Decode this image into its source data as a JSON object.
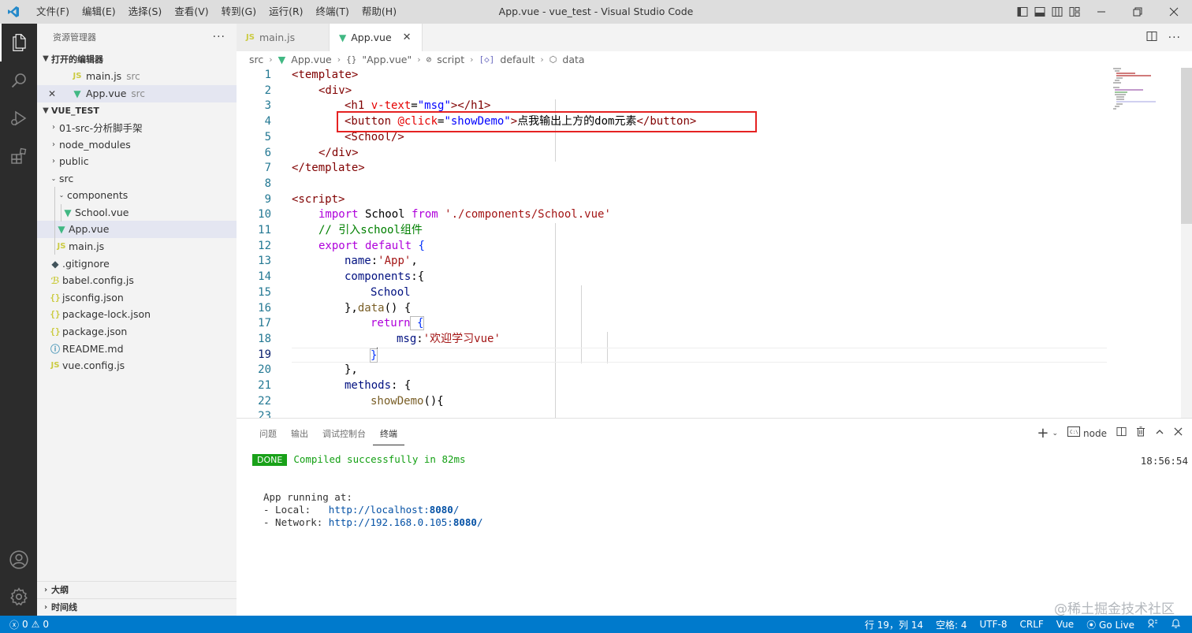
{
  "titlebar": {
    "menu": [
      "文件(F)",
      "编辑(E)",
      "选择(S)",
      "查看(V)",
      "转到(G)",
      "运行(R)",
      "终端(T)",
      "帮助(H)"
    ],
    "window_title": "App.vue - vue_test - Visual Studio Code"
  },
  "sidebar": {
    "title": "资源管理器",
    "open_editors_header": "打开的编辑器",
    "open_editors": [
      {
        "name": "main.js",
        "dir": "src"
      },
      {
        "name": "App.vue",
        "dir": "src"
      }
    ],
    "project_header": "VUE_TEST",
    "tree": {
      "f1": "01-src-分析脚手架",
      "f2": "node_modules",
      "f3": "public",
      "f4": "src",
      "f5": "components",
      "f6": "School.vue",
      "f7": "App.vue",
      "f8": "main.js",
      "f9": ".gitignore",
      "f10": "babel.config.js",
      "f11": "jsconfig.json",
      "f12": "package-lock.json",
      "f13": "package.json",
      "f14": "README.md",
      "f15": "vue.config.js"
    },
    "outline": "大纲",
    "timeline": "时间线"
  },
  "tabs": [
    {
      "label": "main.js"
    },
    {
      "label": "App.vue"
    }
  ],
  "breadcrumb": {
    "p1": "src",
    "p2": "App.vue",
    "p3": "\"App.vue\"",
    "p4": "script",
    "p5": "default",
    "p6": "data"
  },
  "code": {
    "numbers": [
      "1",
      "2",
      "3",
      "4",
      "5",
      "6",
      "7",
      "8",
      "9",
      "10",
      "11",
      "12",
      "13",
      "14",
      "15",
      "16",
      "17",
      "18",
      "19",
      "20",
      "21",
      "22",
      "23"
    ],
    "l1": "<template>",
    "l2": "<div>",
    "l3a": "<h1 ",
    "l3b": "v-text",
    "l3c": "=",
    "l3d": "\"msg\"",
    "l3e": "></h1>",
    "l4a": "<button ",
    "l4b": "@click",
    "l4c": "=",
    "l4d": "\"showDemo\"",
    "l4e": ">",
    "l4f": "点我输出上方的dom元素",
    "l4g": "</button>",
    "l5": "<School/>",
    "l6": "</div>",
    "l7": "</template>",
    "l9": "<script>",
    "l10a": "import",
    "l10b": " School ",
    "l10c": "from",
    "l10d": " './components/School.vue'",
    "l11": "// 引入school组件",
    "l12a": "export",
    "l12b": " default",
    "l12c": " {",
    "l13a": "name",
    "l13b": ":",
    "l13c": "'App'",
    "l13d": ",",
    "l14a": "components",
    "l14b": ":{",
    "l15": "School",
    "l16a": "},",
    "l16b": "data",
    "l16c": "() {",
    "l17a": "return",
    "l17b": " {",
    "l18a": "msg",
    "l18b": ":",
    "l18c": "'欢迎学习vue'",
    "l19": "}",
    "l20": "},",
    "l21a": "methods",
    "l21b": ": {",
    "l22a": "showDemo",
    "l22b": "(){"
  },
  "panel": {
    "tabs": [
      "问题",
      "输出",
      "调试控制台",
      "终端"
    ],
    "terminal_name": "node",
    "done_label": "DONE",
    "compiled_text": "Compiled successfully in 82ms",
    "time": "18:56:54",
    "running": "App running at:",
    "local_label": "- Local:   ",
    "local_url_a": "http://localhost:",
    "local_port": "8080",
    "local_url_b": "/",
    "network_label": "- Network: ",
    "network_url_a": "http://192.168.0.105:",
    "network_port": "8080",
    "network_url_b": "/"
  },
  "statusbar": {
    "errors": "0",
    "warnings": "0",
    "position": "行 19，列 14",
    "spaces": "空格: 4",
    "encoding": "UTF-8",
    "eol": "CRLF",
    "language": "Vue",
    "golive": "Go Live"
  },
  "watermark": "@稀土掘金技术社区",
  "colors": {
    "accent": "#007acc",
    "highlight_box": "#e52222",
    "vue_green": "#41b883"
  }
}
